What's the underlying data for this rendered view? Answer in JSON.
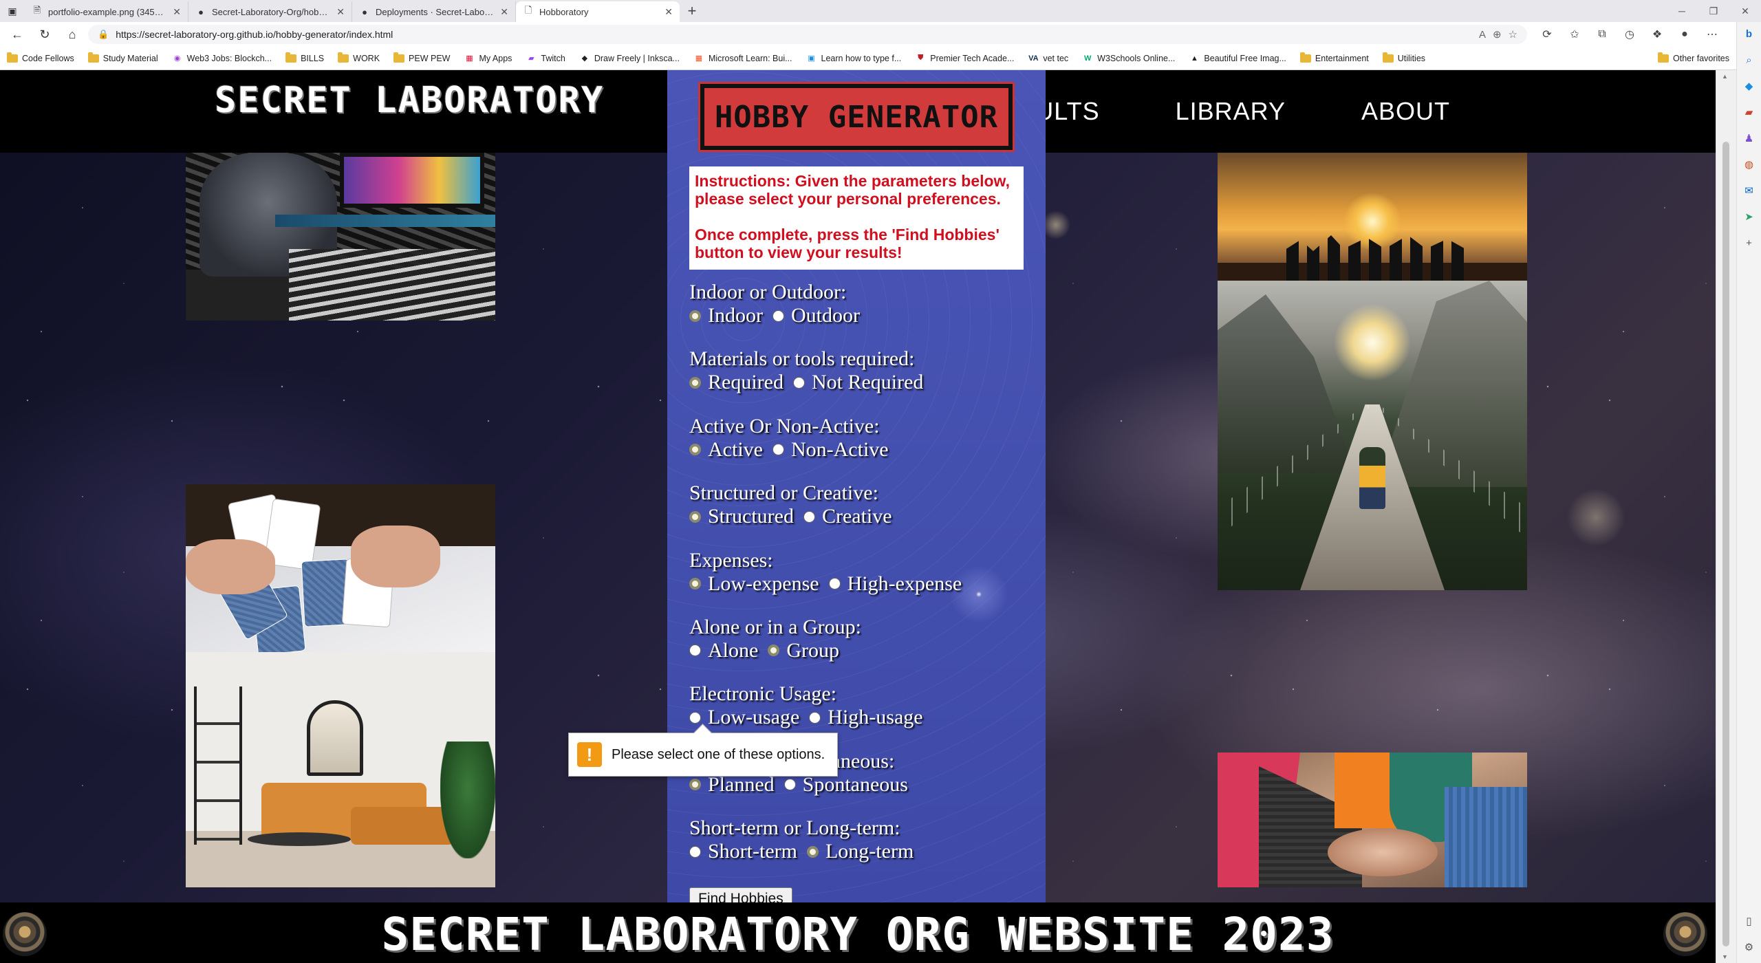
{
  "browser": {
    "tabs": [
      {
        "title": "portfolio-example.png (3456×9…",
        "active": false
      },
      {
        "title": "Secret-Laboratory-Org/hobby-g…",
        "active": false
      },
      {
        "title": "Deployments · Secret-Laboratory…",
        "active": false
      },
      {
        "title": "Hobboratory",
        "active": true
      }
    ],
    "url": "https://secret-laboratory-org.github.io/hobby-generator/index.html",
    "bookmarks": [
      "Code Fellows",
      "Study Material",
      "Web3 Jobs: Blockch...",
      "BILLS",
      "WORK",
      "PEW PEW",
      "My Apps",
      "Twitch",
      "Draw Freely | Inksca...",
      "Microsoft Learn: Bui...",
      "Learn how to type f...",
      "Premier Tech Acade...",
      "vet tec",
      "W3Schools Online...",
      "Beautiful Free Imag...",
      "Entertainment",
      "Utilities"
    ],
    "other_favorites": "Other favorites"
  },
  "site": {
    "logo": "SECRET LABORATORY",
    "nav": [
      "RESULTS",
      "LIBRARY",
      "ABOUT"
    ],
    "title": "HOBBY GENERATOR",
    "instructions": [
      "Instructions: Given the parameters below, please select your personal preferences.",
      "Once complete, press the 'Find Hobbies' button to view your results!"
    ],
    "questions": [
      {
        "label": "Indoor or Outdoor:",
        "options": [
          "Indoor",
          "Outdoor"
        ]
      },
      {
        "label": "Materials or tools required:",
        "options": [
          "Required",
          "Not Required"
        ]
      },
      {
        "label": "Active Or Non-Active:",
        "options": [
          "Active",
          "Non-Active"
        ]
      },
      {
        "label": "Structured or Creative:",
        "options": [
          "Structured",
          "Creative"
        ]
      },
      {
        "label": "Expenses:",
        "options": [
          "Low-expense",
          "High-expense"
        ]
      },
      {
        "label": "Alone or in a Group:",
        "options": [
          "Alone",
          "Group"
        ]
      },
      {
        "label": "Electronic Usage:",
        "options": [
          "Low-usage",
          "High-usage"
        ]
      },
      {
        "label": "Planned or Spontaneous:",
        "options": [
          "Planned",
          "Spontaneous"
        ]
      },
      {
        "label": "Short-term or Long-term:",
        "options": [
          "Short-term",
          "Long-term"
        ]
      }
    ],
    "find_button": "Find Hobbies",
    "tooltip": "Please select one of these options.",
    "footer": "SECRET LABORATORY ORG WEBSITE 2023"
  }
}
